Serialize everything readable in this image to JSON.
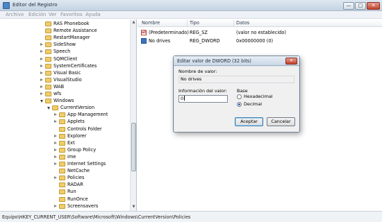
{
  "window": {
    "title": "Editor del Registro",
    "min_glyph": "—",
    "max_glyph": "□",
    "close_glyph": "✕"
  },
  "menu": [
    "Archivo",
    "Edición",
    "Ver",
    "Favoritos",
    "Ayuda"
  ],
  "tree": [
    {
      "label": "RAS Phonebook",
      "expander": "none"
    },
    {
      "label": "Remote Assistance",
      "expander": "none"
    },
    {
      "label": "RestartManager",
      "expander": "none"
    },
    {
      "label": "SideShow",
      "expander": "collapsed"
    },
    {
      "label": "Speech",
      "expander": "collapsed"
    },
    {
      "label": "SQMClient",
      "expander": "collapsed"
    },
    {
      "label": "SystemCertificates",
      "expander": "collapsed"
    },
    {
      "label": "Visual Basic",
      "expander": "collapsed"
    },
    {
      "label": "VisualStudio",
      "expander": "collapsed"
    },
    {
      "label": "WAB",
      "expander": "collapsed"
    },
    {
      "label": "wfs",
      "expander": "collapsed"
    },
    {
      "label": "Windows",
      "expander": "expanded"
    },
    {
      "label": "CurrentVersion",
      "expander": "expanded"
    },
    {
      "label": "App Management",
      "expander": "collapsed"
    },
    {
      "label": "Applets",
      "expander": "collapsed"
    },
    {
      "label": "Controls Folder",
      "expander": "none"
    },
    {
      "label": "Explorer",
      "expander": "collapsed"
    },
    {
      "label": "Ext",
      "expander": "collapsed"
    },
    {
      "label": "Group Policy",
      "expander": "collapsed"
    },
    {
      "label": "ime",
      "expander": "collapsed"
    },
    {
      "label": "Internet Settings",
      "expander": "collapsed"
    },
    {
      "label": "NetCache",
      "expander": "none"
    },
    {
      "label": "Policies",
      "expander": "collapsed"
    },
    {
      "label": "RADAR",
      "expander": "none"
    },
    {
      "label": "Run",
      "expander": "none"
    },
    {
      "label": "RunOnce",
      "expander": "none"
    },
    {
      "label": "Screensavers",
      "expander": "collapsed"
    }
  ],
  "list": {
    "columns": [
      "Nombre",
      "Tipo",
      "Datos"
    ],
    "rows": [
      {
        "icon": "string-value-icon",
        "name": "(Predeterminado)",
        "type": "REG_SZ",
        "data": "(valor no establecido)"
      },
      {
        "icon": "dword-value-icon",
        "name": "No drives",
        "type": "REG_DWORD",
        "data": "0x00000000 (0)"
      }
    ]
  },
  "status": "Equipo\\HKEY_CURRENT_USER\\Software\\Microsoft\\Windows\\CurrentVersion\\Policies",
  "dialog": {
    "title": "Editar valor de DWORD (32 bits)",
    "value_name_label": "Nombre de valor:",
    "value_name": "No drives",
    "value_data_label": "Información del valor:",
    "value_data": "0",
    "base_label": "Base",
    "base_options": [
      {
        "label": "Hexadecimal",
        "selected": false
      },
      {
        "label": "Decimal",
        "selected": true
      }
    ],
    "ok_label": "Aceptar",
    "cancel_label": "Cancelar",
    "close_glyph": "✕"
  }
}
